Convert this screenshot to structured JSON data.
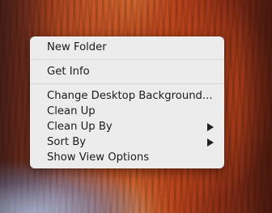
{
  "context_menu": {
    "items": [
      {
        "label": "New Folder"
      },
      {
        "label": "Get Info"
      },
      {
        "label": "Change Desktop Background..."
      },
      {
        "label": "Clean Up"
      },
      {
        "label": "Clean Up By",
        "submenu_icon": "triangle-right-icon"
      },
      {
        "label": "Sort By",
        "submenu_icon": "triangle-right-icon"
      },
      {
        "label": "Show View Options"
      }
    ]
  }
}
